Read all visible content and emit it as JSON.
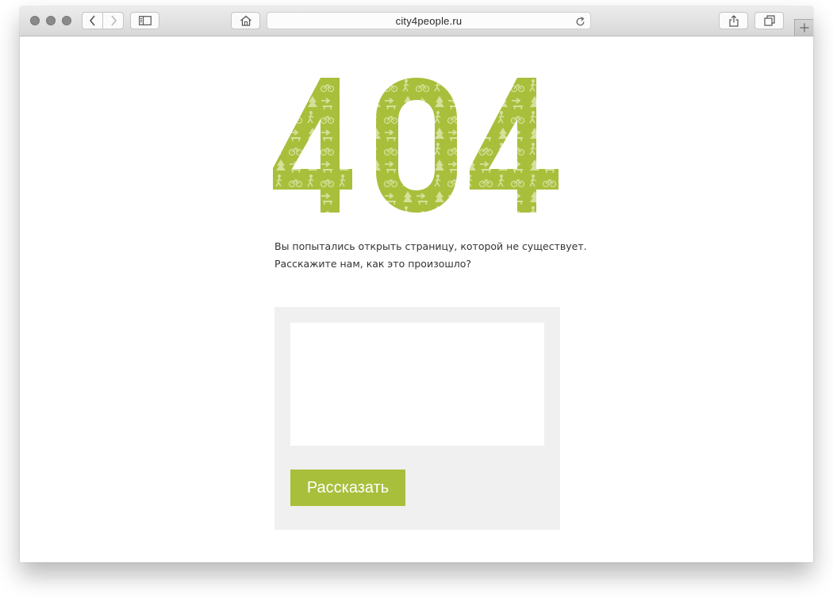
{
  "browser": {
    "url": "city4people.ru"
  },
  "page": {
    "error_code": "404",
    "message_line1": "Вы попытались открыть страницу, которой не существует.",
    "message_line2": "Расскажите нам, как это произошло?",
    "textarea_value": "",
    "submit_label": "Рассказать"
  },
  "colors": {
    "accent": "#a8bf3c",
    "form_bg": "#f0f0f0"
  },
  "icons": [
    "back-arrow-icon",
    "forward-arrow-icon",
    "sidebar-icon",
    "home-icon",
    "reload-icon",
    "share-icon",
    "tabs-icon",
    "plus-icon"
  ]
}
